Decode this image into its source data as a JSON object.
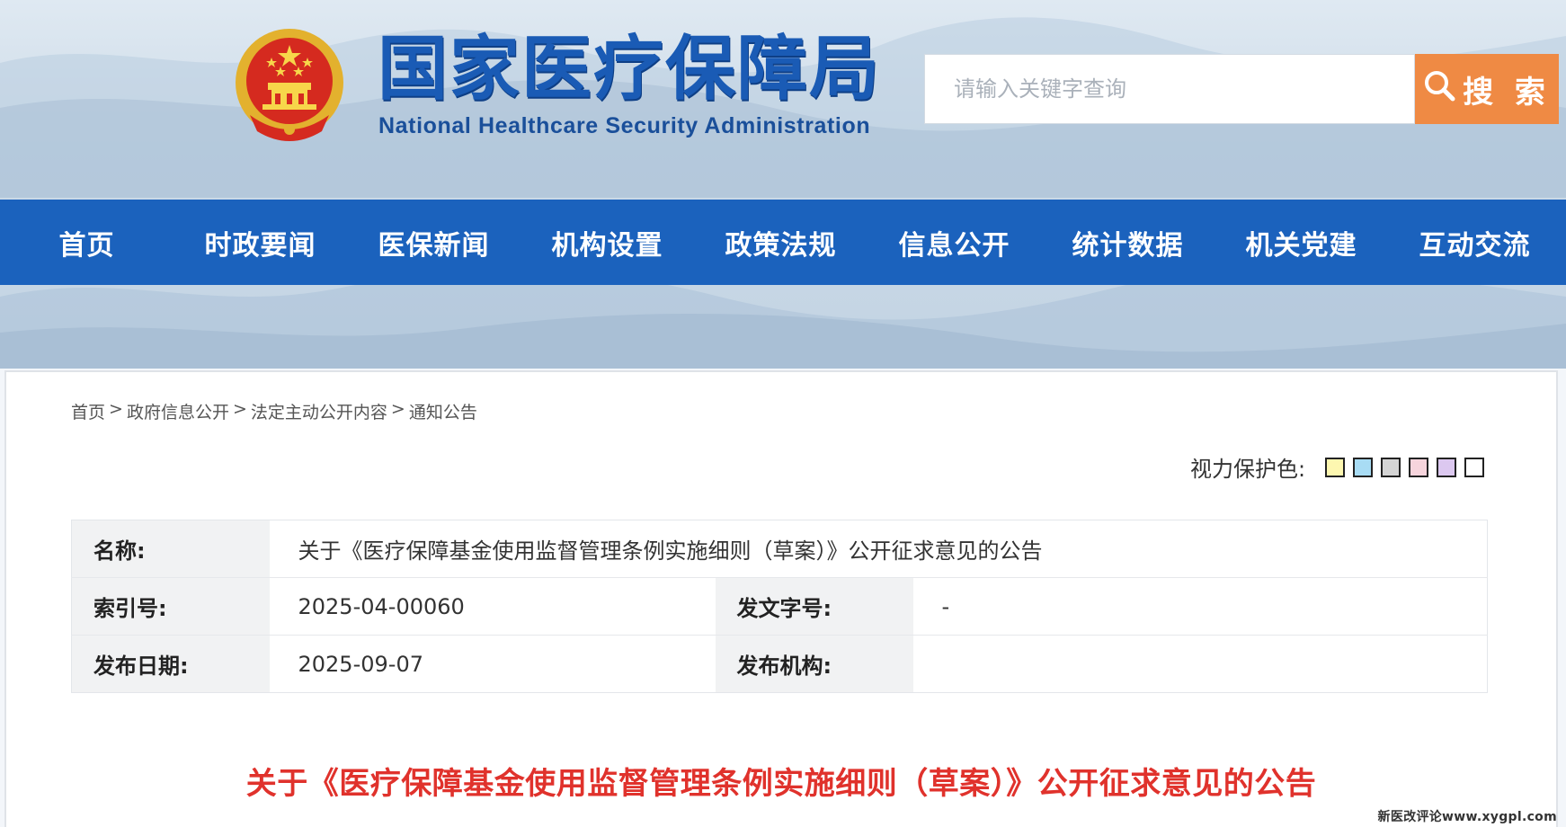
{
  "header": {
    "title_cn": "国家医疗保障局",
    "title_en": "National Healthcare Security Administration",
    "emblem_icon": "national-emblem-icon"
  },
  "search": {
    "placeholder": "请输入关键字查询",
    "button_label": "搜 索",
    "button_color": "#ef8a44"
  },
  "nav": {
    "color": "#1b62bd",
    "items": [
      "首页",
      "时政要闻",
      "医保新闻",
      "机构设置",
      "政策法规",
      "信息公开",
      "统计数据",
      "机关党建",
      "互动交流"
    ]
  },
  "breadcrumb": {
    "items": [
      "首页",
      "政府信息公开",
      "法定主动公开内容",
      "通知公告"
    ],
    "separator": ">"
  },
  "eye_protection": {
    "label": "视力保护色:",
    "swatches": [
      "#fdf7b0",
      "#a8dcf4",
      "#d4d4d4",
      "#f6d4dc",
      "#dcc8f0",
      "#ffffff"
    ]
  },
  "info": {
    "name_label": "名称:",
    "name_value": "关于《医疗保障基金使用监督管理条例实施细则（草案）》公开征求意见的公告",
    "index_label": "索引号:",
    "index_value": "2025-04-00060",
    "docno_label": "发文字号:",
    "docno_value": "-",
    "date_label": "发布日期:",
    "date_value": "2025-09-07",
    "org_label": "发布机构:",
    "org_value": ""
  },
  "article": {
    "title": "关于《医疗保障基金使用监督管理条例实施细则（草案）》公开征求意见的公告",
    "title_color": "#e0322c"
  },
  "watermark": "新医改评论www.xygpl.com"
}
